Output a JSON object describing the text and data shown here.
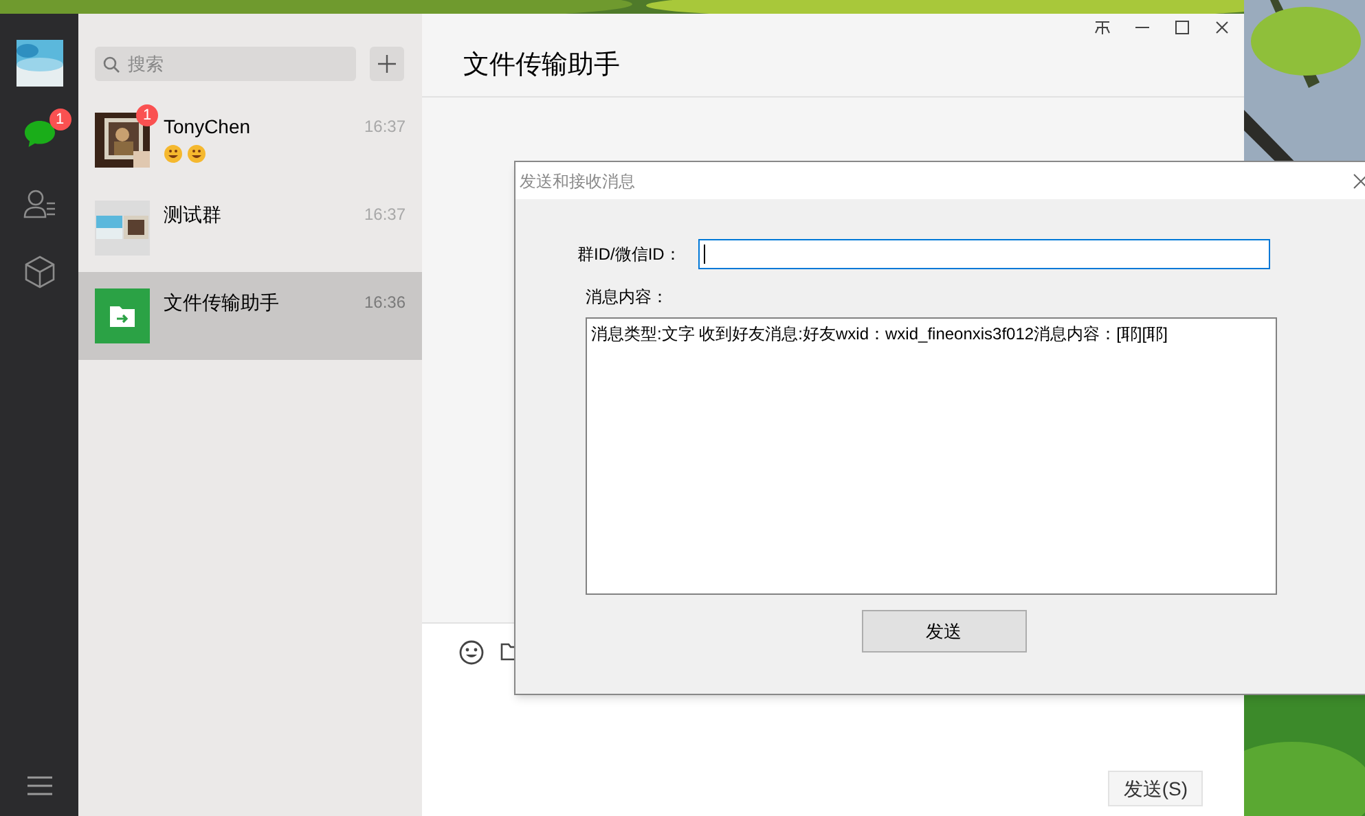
{
  "sidebar": {
    "nav": [
      {
        "kind": "chats",
        "badge": "1",
        "selected": true
      },
      {
        "kind": "contacts",
        "selected": false
      },
      {
        "kind": "favorites",
        "selected": false
      }
    ]
  },
  "search": {
    "placeholder": "搜索"
  },
  "chats": [
    {
      "name": "TonyChen",
      "time": "16:37",
      "badge": "1",
      "preview": [
        {
          "kind": "emoji"
        },
        {
          "kind": "emoji"
        }
      ],
      "selected": false
    },
    {
      "kind": "group",
      "name": "测试群",
      "time": "16:37",
      "selected": false
    },
    {
      "kind": "file-transfer",
      "name": "文件传输助手",
      "time": "16:36",
      "selected": true
    }
  ],
  "chat": {
    "title": "文件传输助手",
    "send_button": "发送(S)"
  },
  "dialog": {
    "title": "发送和接收消息",
    "id_label": "群ID/微信ID：",
    "id_focused": true,
    "content_label": "消息内容：",
    "content": "消息类型:文字 收到好友消息:好友wxid：wxid_fineonxis3f012消息内容：[耶][耶]",
    "send_button": "发送"
  }
}
